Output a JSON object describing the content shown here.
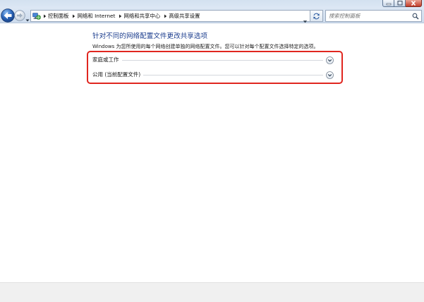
{
  "window": {
    "minimize_icon": "minimize-icon",
    "maximize_icon": "maximize-icon",
    "close_icon": "close-icon"
  },
  "nav": {
    "back_icon": "back-arrow-icon",
    "forward_icon": "forward-arrow-icon",
    "recent_pages_icon": "chevron-down-icon",
    "location_icon": "network-icon",
    "breadcrumbs": [
      "控制面板",
      "网络和 Internet",
      "网络和共享中心",
      "高级共享设置"
    ],
    "separator_icon": "breadcrumb-arrow-icon",
    "address_dropdown_icon": "chevron-down-icon",
    "refresh_icon": "refresh-icon",
    "search_placeholder": "搜索控制面板",
    "search_icon": "search-icon"
  },
  "main": {
    "title": "针对不同的网络配置文件更改共享选项",
    "description": "Windows 为您所使用的每个网络创建单独的网络配置文件。您可以针对每个配置文件选择特定的选项。",
    "profiles": [
      {
        "label": "家庭或工作",
        "expand_icon": "chevron-down-circle-icon"
      },
      {
        "label": "公用 (当前配置文件)",
        "expand_icon": "chevron-down-circle-icon"
      }
    ]
  },
  "colors": {
    "heading": "#1e3f8f",
    "highlight_box": "#e0261f",
    "close_button": "#c33d2a",
    "back_button": "#2a64b8"
  }
}
